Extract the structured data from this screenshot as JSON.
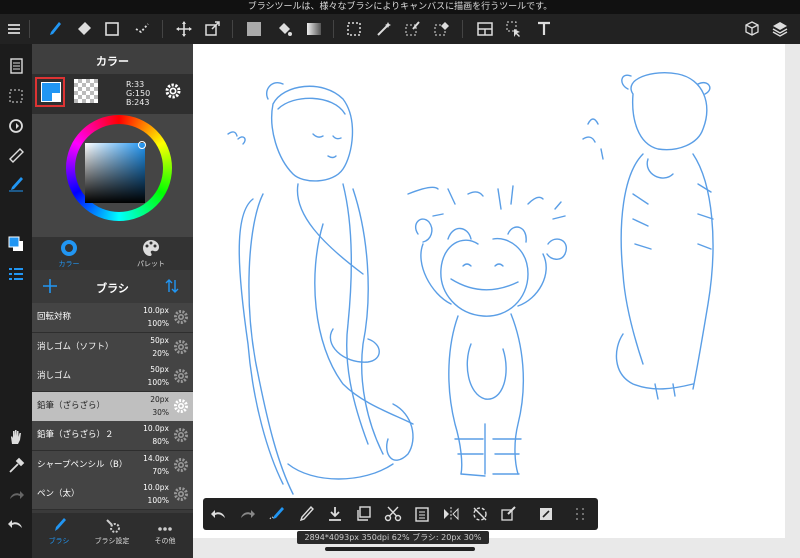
{
  "top_message": "ブラシツールは、様々なブラシによりキャンバスに描画を行うツールです。",
  "panel": {
    "color_title": "カラー",
    "rgb": {
      "r": "R:33",
      "g": "G:150",
      "b": "B:243"
    },
    "tabs": [
      {
        "label": "カラー"
      },
      {
        "label": "パレット"
      }
    ],
    "brush_title": "ブラシ",
    "brushes": [
      {
        "name": "回転対称",
        "size": "10.0px",
        "opacity": "100%"
      },
      {
        "name": "消しゴム（ソフト）",
        "size": "50px",
        "opacity": "20%"
      },
      {
        "name": "消しゴム",
        "size": "50px",
        "opacity": "100%"
      },
      {
        "name": "鉛筆（ざらざら）",
        "size": "20px",
        "opacity": "30%"
      },
      {
        "name": "鉛筆（ざらざら）２",
        "size": "10.0px",
        "opacity": "80%"
      },
      {
        "name": "シャープペンシル（B）",
        "size": "14.0px",
        "opacity": "70%"
      },
      {
        "name": "ペン（太）",
        "size": "10.0px",
        "opacity": "100%"
      }
    ],
    "bottom_tabs": [
      {
        "label": "ブラシ"
      },
      {
        "label": "ブラシ設定"
      },
      {
        "label": "その他"
      }
    ]
  },
  "status": "2894*4093px 350dpi 62% ブラシ: 20px 30%",
  "colors": {
    "accent": "#2196f3",
    "stroke": "#5a9ee6"
  }
}
